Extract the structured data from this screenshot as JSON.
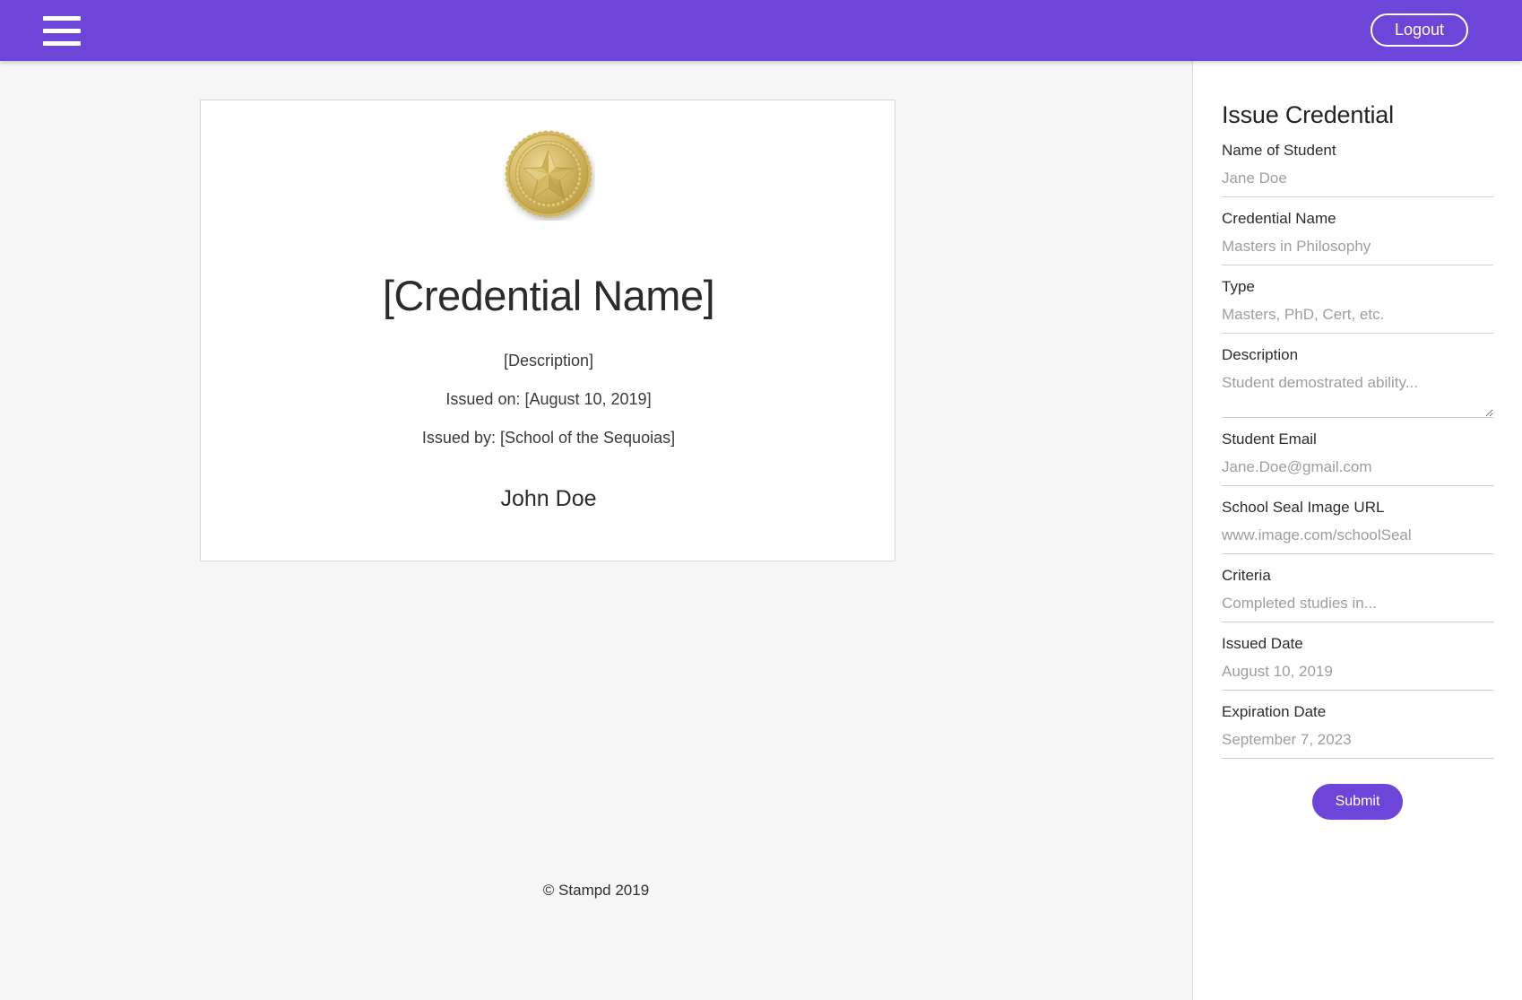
{
  "theme": {
    "brand_purple": "#6e45d9",
    "page_background": "#f6f6f6",
    "card_background": "#ffffff",
    "card_border": "#d8d8d8",
    "placeholder_color": "#9e9e9e",
    "text_color": "#2c2c2c"
  },
  "navbar": {
    "menu_icon": "hamburger-menu-icon",
    "logout_label": "Logout"
  },
  "credential_preview": {
    "seal_icon": "gold-star-seal-image",
    "title": "[Credential Name]",
    "description": "[Description]",
    "issued_on": "Issued on: [August 10, 2019]",
    "issued_by": "Issued by: [School of the Sequoias]",
    "student_name": "John Doe"
  },
  "footer": {
    "copyright": "© Stampd 2019"
  },
  "form": {
    "title": "Issue Credential",
    "fields": [
      {
        "label": "Name of Student",
        "placeholder": "Jane Doe",
        "value": "",
        "type": "text"
      },
      {
        "label": "Credential Name",
        "placeholder": "Masters in Philosophy",
        "value": "",
        "type": "text"
      },
      {
        "label": "Type",
        "placeholder": "Masters, PhD, Cert, etc.",
        "value": "",
        "type": "text"
      },
      {
        "label": "Description",
        "placeholder": "Student demostrated ability...",
        "value": "",
        "type": "textarea"
      },
      {
        "label": "Student Email",
        "placeholder": "Jane.Doe@gmail.com",
        "value": "",
        "type": "text"
      },
      {
        "label": "School Seal Image URL",
        "placeholder": "www.image.com/schoolSeal",
        "value": "",
        "type": "text"
      },
      {
        "label": "Criteria",
        "placeholder": "Completed studies in...",
        "value": "",
        "type": "text"
      },
      {
        "label": "Issued Date",
        "placeholder": "August 10, 2019",
        "value": "",
        "type": "text"
      },
      {
        "label": "Expiration Date",
        "placeholder": "September 7, 2023",
        "value": "",
        "type": "text"
      }
    ],
    "submit_label": "Submit"
  }
}
